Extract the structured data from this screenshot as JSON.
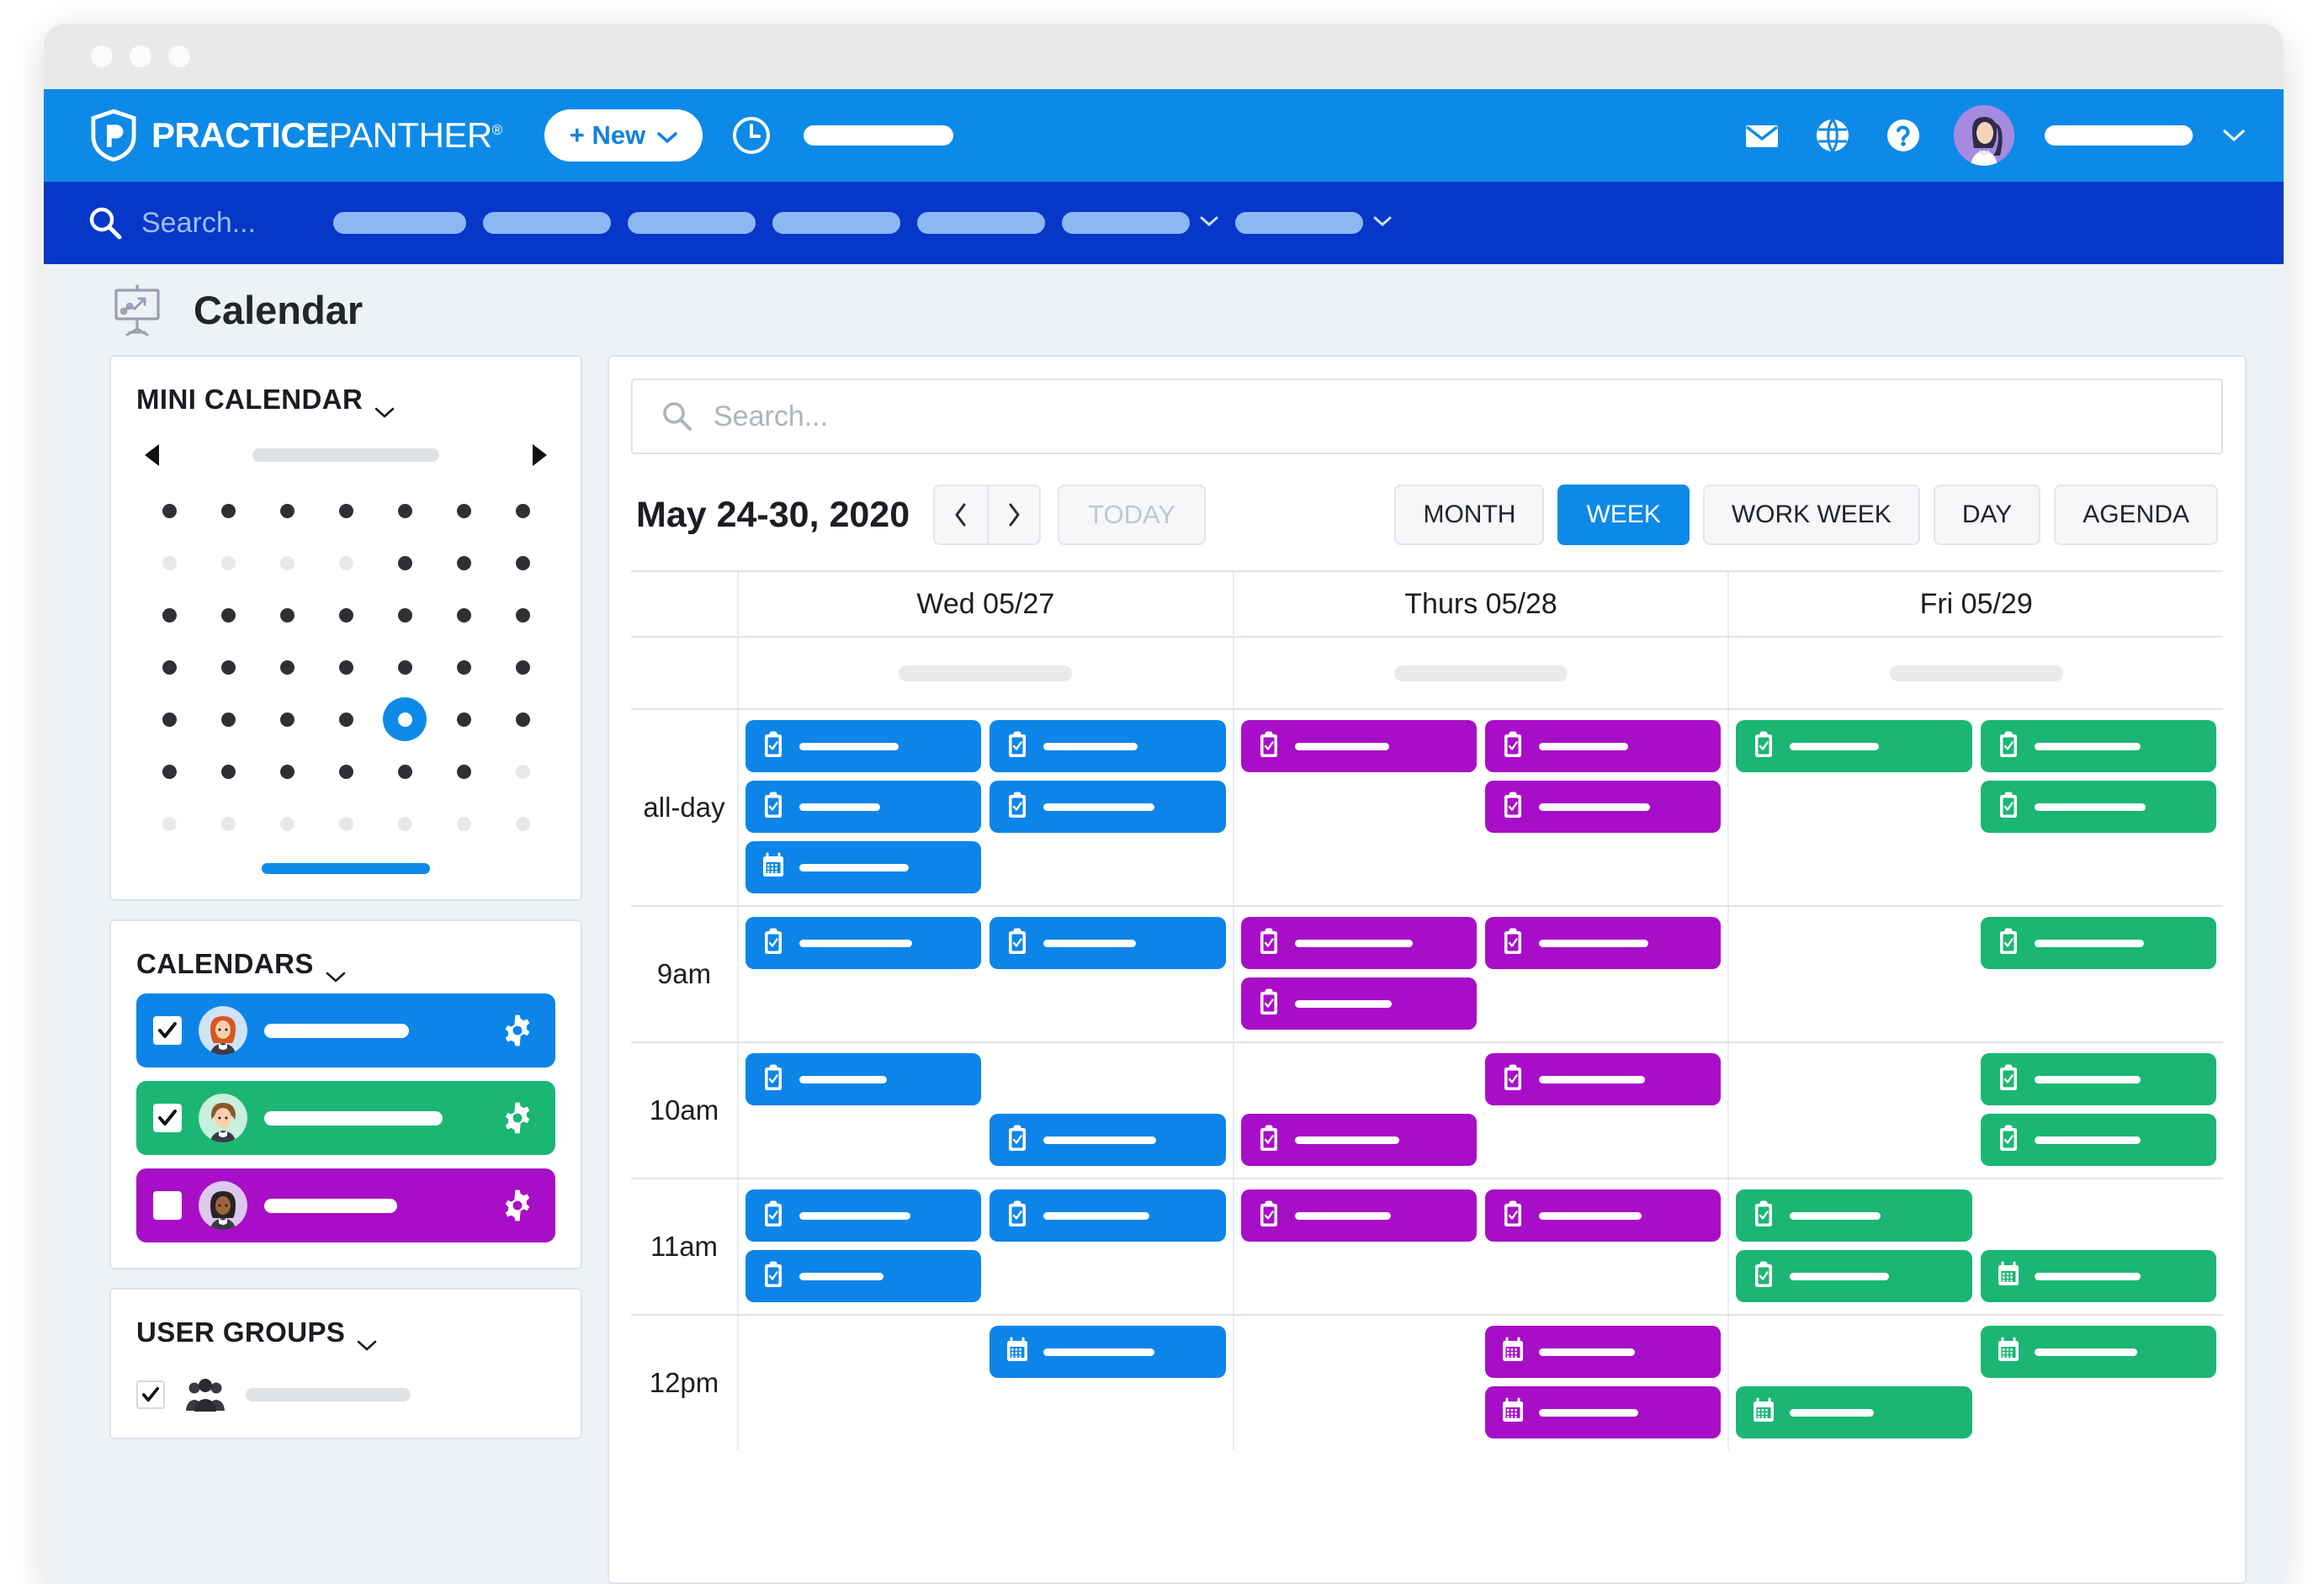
{
  "window": {
    "dots": [
      "close",
      "minimize",
      "maximize"
    ]
  },
  "topbar": {
    "brand_bold": "PRACTICE",
    "brand_thin": "PANTHER",
    "brand_reg": "®",
    "new_button_label": "+ New",
    "icons": [
      "shield-p-logo-icon",
      "chevron-down-icon",
      "clock-icon",
      "envelope-icon",
      "globe-icon",
      "help-circle-icon",
      "avatar",
      "chevron-down-icon"
    ],
    "accent": "#0d8ae8"
  },
  "navbar": {
    "search_placeholder": "Search...",
    "background": "#0637c9",
    "items": [
      {
        "name": "nav-pill-1",
        "width": 158,
        "has_chevron": false
      },
      {
        "name": "nav-pill-2",
        "width": 152,
        "has_chevron": false
      },
      {
        "name": "nav-pill-3",
        "width": 152,
        "has_chevron": false
      },
      {
        "name": "nav-pill-4",
        "width": 152,
        "has_chevron": false
      },
      {
        "name": "nav-pill-5",
        "width": 152,
        "has_chevron": false
      },
      {
        "name": "nav-pill-6",
        "width": 152,
        "has_chevron": true
      },
      {
        "name": "nav-pill-7",
        "width": 152,
        "has_chevron": true
      }
    ]
  },
  "page": {
    "title": "Calendar",
    "icon": "presentation-chart-icon"
  },
  "sidebar": {
    "mini_calendar": {
      "title": "MINI CALENDAR",
      "prev_icon": "triangle-left-icon",
      "next_icon": "triangle-right-icon",
      "weeks": [
        [
          "on",
          "on",
          "on",
          "on",
          "on",
          "on",
          "on"
        ],
        [
          "off",
          "off",
          "off",
          "off",
          "on",
          "on",
          "on"
        ],
        [
          "on",
          "on",
          "on",
          "on",
          "on",
          "on",
          "on"
        ],
        [
          "on",
          "on",
          "on",
          "on",
          "on",
          "on",
          "on"
        ],
        [
          "on",
          "on",
          "on",
          "on",
          "selected",
          "on",
          "on"
        ],
        [
          "on",
          "on",
          "on",
          "on",
          "on",
          "on",
          "off"
        ],
        [
          "off",
          "off",
          "off",
          "off",
          "off",
          "off",
          "off"
        ]
      ]
    },
    "calendars": {
      "title": "CALENDARS",
      "rows": [
        {
          "name": "calendar-user-1",
          "color": "#0d85e8",
          "checked": true,
          "avatar": "woman-redhair-avatar",
          "name_width": 172
        },
        {
          "name": "calendar-user-2",
          "color": "#1bb673",
          "checked": true,
          "avatar": "man-brownhair-avatar",
          "name_width": 212
        },
        {
          "name": "calendar-user-3",
          "color": "#a80ec7",
          "checked": false,
          "avatar": "woman-darkhair-avatar",
          "name_width": 158
        }
      ]
    },
    "user_groups": {
      "title": "USER GROUPS",
      "rows": [
        {
          "name": "user-group-1",
          "checked": true,
          "icon": "people-group-icon"
        }
      ]
    }
  },
  "calendar": {
    "search_placeholder": "Search...",
    "date_range": "May 24-30, 2020",
    "prev_label": "previous-week",
    "next_label": "next-week",
    "today_label": "TODAY",
    "views": [
      {
        "label": "MONTH",
        "active": false
      },
      {
        "label": "WEEK",
        "active": true
      },
      {
        "label": "WORK WEEK",
        "active": false
      },
      {
        "label": "DAY",
        "active": false
      },
      {
        "label": "AGENDA",
        "active": false
      }
    ],
    "days": [
      {
        "label": "Wed 05/27",
        "placeholder_width": 206
      },
      {
        "label": "Thurs 05/28",
        "placeholder_width": 206
      },
      {
        "label": "Fri 05/29",
        "placeholder_width": 206
      }
    ],
    "time_rows": [
      "all-day",
      "9am",
      "10am",
      "11am",
      "12pm"
    ],
    "events": {
      "all-day": [
        {
          "day": "Wed 05/27",
          "lane": "left",
          "items": [
            {
              "type": "task",
              "color": "#0d85e8",
              "width": 118
            },
            {
              "type": "task",
              "color": "#0d85e8",
              "width": 96
            },
            {
              "type": "event",
              "color": "#0d85e8",
              "width": 130
            }
          ]
        },
        {
          "day": "Wed 05/27",
          "lane": "right",
          "items": [
            {
              "type": "task",
              "color": "#0d85e8",
              "width": 112
            },
            {
              "type": "task",
              "color": "#0d85e8",
              "width": 132
            }
          ]
        },
        {
          "day": "Thurs 05/28",
          "lane": "left",
          "items": [
            {
              "type": "task",
              "color": "#a80ec7",
              "width": 112
            }
          ]
        },
        {
          "day": "Thurs 05/28",
          "lane": "right",
          "items": [
            {
              "type": "task",
              "color": "#a80ec7",
              "width": 106
            },
            {
              "type": "task",
              "color": "#a80ec7",
              "width": 132
            }
          ]
        },
        {
          "day": "Fri 05/29",
          "lane": "left",
          "items": [
            {
              "type": "task",
              "color": "#1bb673",
              "width": 106
            }
          ]
        },
        {
          "day": "Fri 05/29",
          "lane": "right",
          "items": [
            {
              "type": "task",
              "color": "#1bb673",
              "width": 126
            },
            {
              "type": "task",
              "color": "#1bb673",
              "width": 132
            }
          ]
        }
      ],
      "9am": [
        {
          "day": "Wed 05/27",
          "lane": "left",
          "items": [
            {
              "type": "task",
              "color": "#0d85e8",
              "width": 134
            }
          ]
        },
        {
          "day": "Wed 05/27",
          "lane": "right",
          "items": [
            {
              "type": "task",
              "color": "#0d85e8",
              "width": 110
            }
          ]
        },
        {
          "day": "Thurs 05/28",
          "lane": "left",
          "items": [
            {
              "type": "task",
              "color": "#a80ec7",
              "width": 140
            },
            {
              "type": "task",
              "color": "#a80ec7",
              "width": 115
            }
          ]
        },
        {
          "day": "Thurs 05/28",
          "lane": "right",
          "items": [
            {
              "type": "task",
              "color": "#a80ec7",
              "width": 130
            }
          ]
        },
        {
          "day": "Fri 05/29",
          "lane": "left",
          "items": []
        },
        {
          "day": "Fri 05/29",
          "lane": "right",
          "items": [
            {
              "type": "task",
              "color": "#1bb673",
              "width": 130
            }
          ]
        }
      ],
      "10am": [
        {
          "day": "Wed 05/27",
          "lane": "left",
          "items": [
            {
              "type": "task",
              "color": "#0d85e8",
              "width": 104
            }
          ]
        },
        {
          "day": "Wed 05/27",
          "lane": "right",
          "items": [
            {
              "type": "spacer"
            },
            {
              "type": "task",
              "color": "#0d85e8",
              "width": 134
            }
          ]
        },
        {
          "day": "Thurs 05/28",
          "lane": "left",
          "items": [
            {
              "type": "spacer"
            },
            {
              "type": "task",
              "color": "#a80ec7",
              "width": 124
            }
          ]
        },
        {
          "day": "Thurs 05/28",
          "lane": "right",
          "items": [
            {
              "type": "task",
              "color": "#a80ec7",
              "width": 126
            }
          ]
        },
        {
          "day": "Fri 05/29",
          "lane": "left",
          "items": []
        },
        {
          "day": "Fri 05/29",
          "lane": "right",
          "items": [
            {
              "type": "task",
              "color": "#1bb673",
              "width": 126
            },
            {
              "type": "task",
              "color": "#1bb673",
              "width": 126
            }
          ]
        }
      ],
      "11am": [
        {
          "day": "Wed 05/27",
          "lane": "left",
          "items": [
            {
              "type": "task",
              "color": "#0d85e8",
              "width": 132
            },
            {
              "type": "task",
              "color": "#0d85e8",
              "width": 100
            }
          ]
        },
        {
          "day": "Wed 05/27",
          "lane": "right",
          "items": [
            {
              "type": "task",
              "color": "#0d85e8",
              "width": 126
            }
          ]
        },
        {
          "day": "Thurs 05/28",
          "lane": "left",
          "items": [
            {
              "type": "task",
              "color": "#a80ec7",
              "width": 114
            }
          ]
        },
        {
          "day": "Thurs 05/28",
          "lane": "right",
          "items": [
            {
              "type": "task",
              "color": "#a80ec7",
              "width": 122
            }
          ]
        },
        {
          "day": "Fri 05/29",
          "lane": "left",
          "items": [
            {
              "type": "task",
              "color": "#1bb673",
              "width": 108
            },
            {
              "type": "task",
              "color": "#1bb673",
              "width": 118
            }
          ]
        },
        {
          "day": "Fri 05/29",
          "lane": "right",
          "items": [
            {
              "type": "spacer"
            },
            {
              "type": "event",
              "color": "#1bb673",
              "width": 126
            }
          ]
        }
      ],
      "12pm": [
        {
          "day": "Wed 05/27",
          "lane": "left",
          "items": []
        },
        {
          "day": "Wed 05/27",
          "lane": "right",
          "items": [
            {
              "type": "event",
              "color": "#0d85e8",
              "width": 132
            }
          ]
        },
        {
          "day": "Thurs 05/28",
          "lane": "left",
          "items": []
        },
        {
          "day": "Thurs 05/28",
          "lane": "right",
          "items": [
            {
              "type": "event",
              "color": "#a80ec7",
              "width": 114
            },
            {
              "type": "event",
              "color": "#a80ec7",
              "width": 118
            }
          ]
        },
        {
          "day": "Fri 05/29",
          "lane": "left",
          "items": [
            {
              "type": "spacer"
            },
            {
              "type": "event",
              "color": "#1bb673",
              "width": 100
            }
          ]
        },
        {
          "day": "Fri 05/29",
          "lane": "right",
          "items": [
            {
              "type": "event",
              "color": "#1bb673",
              "width": 122
            }
          ]
        }
      ]
    }
  }
}
